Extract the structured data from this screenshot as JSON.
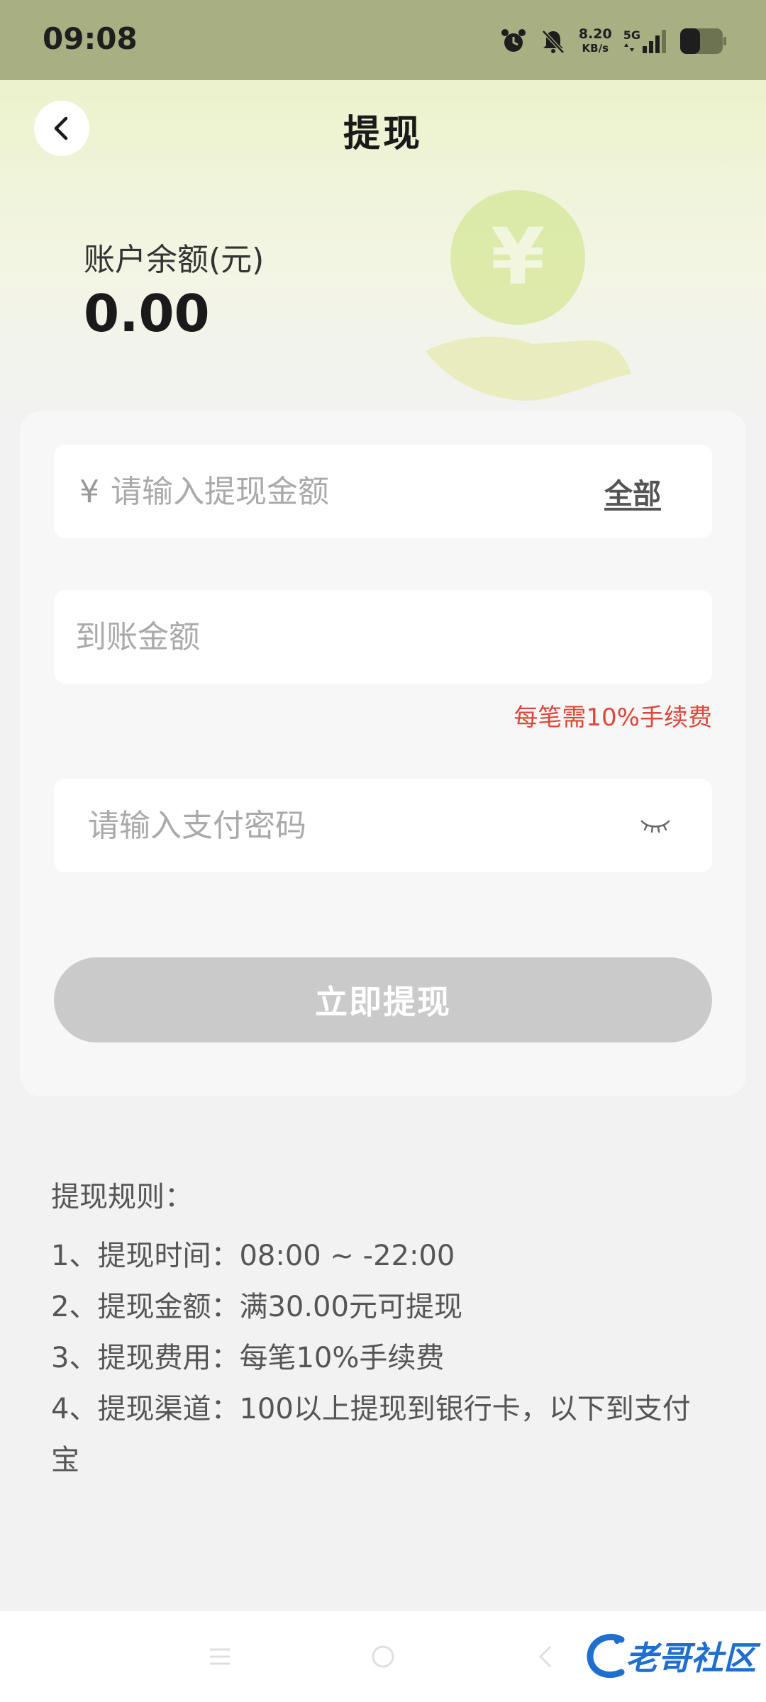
{
  "status": {
    "time": "09:08",
    "net_speed_value": "8.20",
    "net_speed_unit": "KB/s",
    "network": "5G",
    "icons": [
      "alarm-icon",
      "mute-bell-icon",
      "signal-icon",
      "battery-icon"
    ]
  },
  "header": {
    "title": "提现",
    "back_icon": "chevron-left-icon"
  },
  "balance": {
    "label": "账户余额(元)",
    "value": "0.00"
  },
  "form": {
    "currency_symbol": "¥",
    "amount_placeholder": "请输入提现金额",
    "all_label": "全部",
    "received_placeholder": "到账金额",
    "fee_note": "每笔需10%手续费",
    "password_placeholder": "请输入支付密码",
    "submit_label": "立即提现"
  },
  "rules": {
    "title": "提现规则：",
    "items": [
      "1、提现时间：08:00 ~ -22:00",
      "2、提现金额：满30.00元可提现",
      "3、提现费用：每笔10%手续费",
      "4、提现渠道：100以上提现到银行卡，以下到支付宝"
    ]
  },
  "watermark": {
    "text": "老哥社区"
  },
  "colors": {
    "status_bar": "#a8b083",
    "accent_red": "#e0463a",
    "button_disabled": "#cacaca"
  }
}
